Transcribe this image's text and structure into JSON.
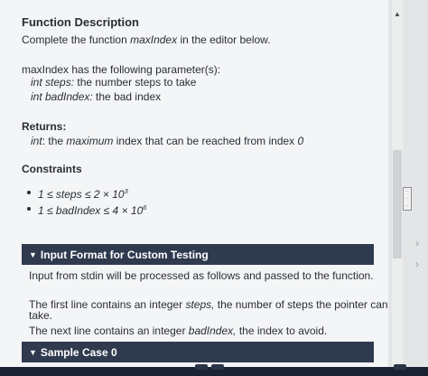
{
  "heading": "Function Description",
  "intro": {
    "prefix": "Complete the function ",
    "function_name": "maxIndex",
    "suffix": " in the editor below."
  },
  "params_heading": "maxIndex has the following parameter(s):",
  "params": [
    {
      "name": "int steps:",
      "desc": " the number steps to take"
    },
    {
      "name": "int badIndex:",
      "desc": " the bad index"
    }
  ],
  "returns": {
    "heading": "Returns:",
    "type": "int",
    "desc_prefix": ": the ",
    "desc_italic": "maximum",
    "desc_suffix": " index that can be reached from index ",
    "index": "0"
  },
  "constraints": {
    "heading": "Constraints",
    "items": [
      {
        "text": "1 ≤ steps ≤ 2 × 10",
        "exp": "3"
      },
      {
        "text": "1 ≤ badIndex ≤ 4 × 10",
        "exp": "6"
      }
    ]
  },
  "input_format": {
    "label": "Input Format for Custom Testing",
    "line1": "Input from stdin will be processed as follows and passed to the function.",
    "line2_prefix": "The first line contains an integer ",
    "line2_italic": "steps,",
    "line2_suffix": " the number of steps the pointer can",
    "line2_wrap": "take.",
    "line3_prefix": "The next line contains an integer ",
    "line3_italic": "badIndex,",
    "line3_suffix": " the index to avoid."
  },
  "sample_case": {
    "label": "Sample Case 0"
  },
  "colors": {
    "section_bar": "#2f3a4f",
    "panel_bg": "#f4f5f6",
    "text": "#2a2d33"
  },
  "icons": {
    "collapse_triangle": "triangle-down-icon",
    "scroll_up": "chevron-up-icon",
    "drag_handle": "grip-icon"
  }
}
